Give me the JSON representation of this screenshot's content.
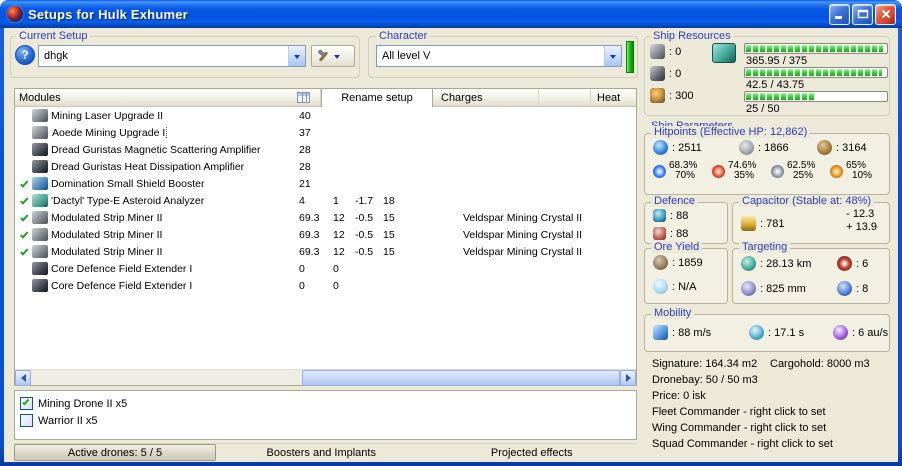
{
  "colors": {
    "accent-blue": "#2B3FC0",
    "check-green": "#23A323",
    "bar-green": "#3FD43F",
    "titlebar-blue": "#0054E3",
    "close-red": "#D44530",
    "client-bg": "#ECE9D8"
  },
  "window": {
    "title": "Setups for Hulk Exhumer"
  },
  "setup": {
    "label": "Current Setup",
    "value": "dhgk",
    "help_glyph": "?"
  },
  "character": {
    "label": "Character",
    "value": "All level V"
  },
  "ship_resources": {
    "label": "Ship Resources",
    "turret_hardpoints": ": 0",
    "launcher_hardpoints": ": 0",
    "calibration": ": 300",
    "cpu": {
      "text": "365.95 / 375",
      "pct": 97.6
    },
    "powergrid": {
      "text": "42.5 / 43.75",
      "pct": 97.1
    },
    "bandwidth": {
      "text": "25 / 50",
      "pct": 50
    }
  },
  "modules": {
    "header": "Modules",
    "tab_rename": "Rename setup",
    "tab_charges": "Charges",
    "tab_heat": "Heat",
    "rows": [
      {
        "fitted": false,
        "name": "Mining Laser Upgrade II",
        "c1": "40"
      },
      {
        "fitted": false,
        "name": "Aoede Mining Upgrade I",
        "c1": "37"
      },
      {
        "fitted": false,
        "name": "Dread Guristas Magnetic Scattering Amplifier",
        "c1": "28"
      },
      {
        "fitted": false,
        "name": "Dread Guristas Heat Dissipation Amplifier",
        "c1": "28"
      },
      {
        "fitted": true,
        "name": "Domination Small Shield Booster",
        "c1": "21"
      },
      {
        "fitted": true,
        "name": "'Dactyl' Type-E Asteroid Analyzer",
        "c1": "4",
        "c2": "1",
        "c3": "-1.7",
        "c4": "18"
      },
      {
        "fitted": true,
        "name": "Modulated Strip Miner II",
        "c1": "69.3",
        "c2": "12",
        "c3": "-0.5",
        "c4": "15",
        "charge": "Veldspar Mining Crystal II"
      },
      {
        "fitted": true,
        "name": "Modulated Strip Miner II",
        "c1": "69.3",
        "c2": "12",
        "c3": "-0.5",
        "c4": "15",
        "charge": "Veldspar Mining Crystal II"
      },
      {
        "fitted": true,
        "name": "Modulated Strip Miner II",
        "c1": "69.3",
        "c2": "12",
        "c3": "-0.5",
        "c4": "15",
        "charge": "Veldspar Mining Crystal II"
      },
      {
        "fitted": false,
        "name": "Core Defence Field Extender I",
        "c1": "0",
        "c2": "0"
      },
      {
        "fitted": false,
        "name": "Core Defence Field Extender I",
        "c1": "0",
        "c2": "0"
      }
    ]
  },
  "parameters": {
    "label": "Ship Parameters",
    "hitpoints": {
      "label": "Hitpoints (Effective HP: 12,862)",
      "shield": ": 2511",
      "armor": ": 1866",
      "structure": ": 3164",
      "resists": [
        {
          "shield": "68.3%",
          "armor": "70%"
        },
        {
          "shield": "74.6%",
          "armor": "35%"
        },
        {
          "shield": "62.5%",
          "armor": "25%"
        },
        {
          "shield": "65%",
          "armor": "10%"
        }
      ]
    },
    "defence": {
      "label": "Defence",
      "shield_recharge": ": 88",
      "shield_boost": ": 88"
    },
    "capacitor": {
      "label": "Capacitor (Stable at: 48%)",
      "capacity": ": 781",
      "usage": "- 12.3",
      "recharge": "+ 13.9"
    },
    "ore_yield": {
      "label": "Ore Yield",
      "ore": ": 1859",
      "ice": ": N/A"
    },
    "targeting": {
      "label": "Targeting",
      "range": ": 28.13 km",
      "max_targets": ": 6",
      "scan_resolution": ": 825 mm",
      "sensor_strength": ": 8"
    },
    "mobility": {
      "label": "Mobility",
      "speed": ": 88 m/s",
      "align_time": ": 17.1 s",
      "warp_speed": ": 6 au/s"
    },
    "signature": "Signature: 164.34 m2",
    "cargohold": "Cargohold: 8000 m3",
    "dronebay": "Dronebay: 50 / 50 m3",
    "price": "Price: 0 isk",
    "fleet_commander": "Fleet Commander - right click to set",
    "wing_commander": "Wing Commander - right click to set",
    "squad_commander": "Squad Commander - right click to set"
  },
  "drones": {
    "rows": [
      {
        "checked": true,
        "label": "Mining Drone II x5"
      },
      {
        "checked": false,
        "label": "Warrior II x5"
      }
    ]
  },
  "bottom": {
    "active_drones": "Active drones: 5 / 5",
    "boosters": "Boosters and Implants",
    "projected": "Projected effects"
  }
}
